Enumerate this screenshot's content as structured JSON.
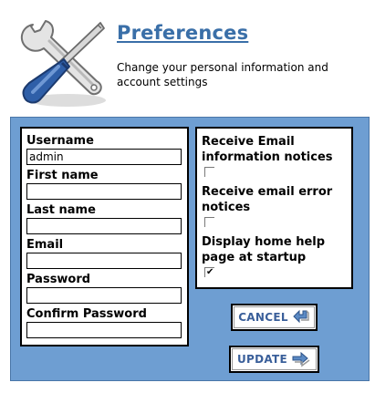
{
  "header": {
    "title": "Preferences",
    "subtitle": "Change your personal information and account settings",
    "icon": "tools-icon"
  },
  "form": {
    "fields": [
      {
        "label": "Username",
        "value": "admin"
      },
      {
        "label": "First name",
        "value": ""
      },
      {
        "label": "Last name",
        "value": ""
      },
      {
        "label": "Email",
        "value": ""
      },
      {
        "label": "Password",
        "value": ""
      },
      {
        "label": "Confirm Password",
        "value": ""
      }
    ]
  },
  "notices": [
    {
      "label": "Receive Email information notices",
      "checked": false
    },
    {
      "label": "Receive email error notices",
      "checked": false
    },
    {
      "label": "Display home help page at startup",
      "checked": true
    }
  ],
  "buttons": {
    "cancel_label": "CANCEL",
    "update_label": "UPDATE"
  },
  "colors": {
    "panel": "#6e9ed2",
    "title": "#3a6fa8",
    "button_text": "#3a5f9a",
    "arrow": "#5b8ac4"
  }
}
